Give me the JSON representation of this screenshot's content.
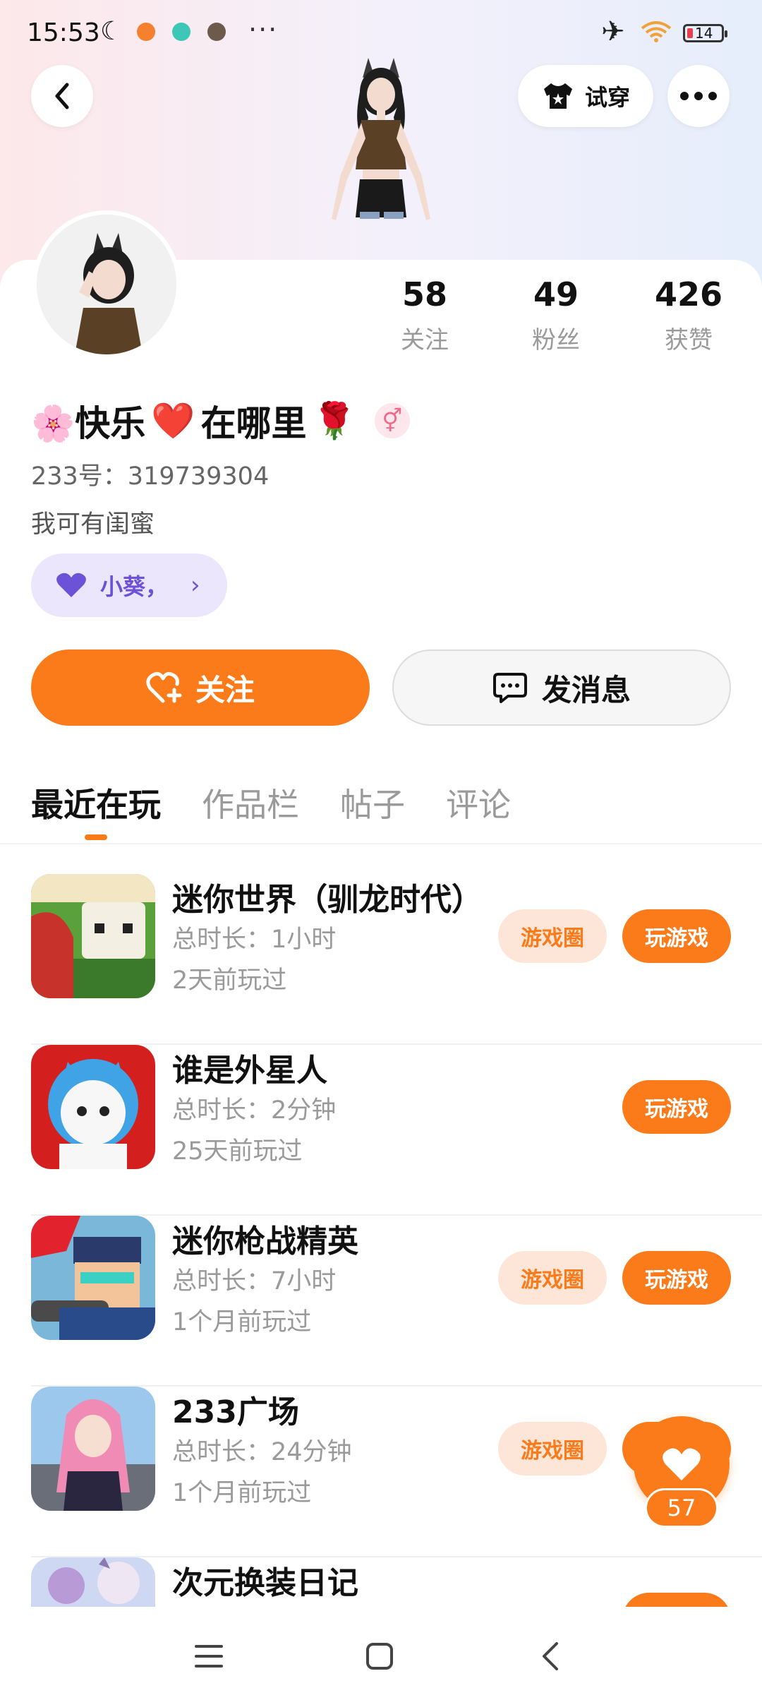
{
  "status_bar": {
    "time": "15:53",
    "battery": "14",
    "more": "···"
  },
  "header": {
    "try_on_label": "试穿"
  },
  "stats": [
    {
      "value": "58",
      "label": "关注"
    },
    {
      "value": "49",
      "label": "粉丝"
    },
    {
      "value": "426",
      "label": "获赞"
    }
  ],
  "profile": {
    "nickname_pre": "🌸快乐",
    "nickname_heart": "❤️",
    "nickname_mid": "在哪里",
    "nickname_post": "🌹",
    "gender_symbol": "⚥",
    "uid": "233号：319739304",
    "bio": "我可有闺蜜",
    "bestie_name": "小葵，"
  },
  "actions": {
    "follow_label": "关注",
    "message_label": "发消息"
  },
  "tabs": [
    {
      "label": "最近在玩",
      "active": true
    },
    {
      "label": "作品栏",
      "active": false
    },
    {
      "label": "帖子",
      "active": false
    },
    {
      "label": "评论",
      "active": false
    }
  ],
  "games": [
    {
      "name": "迷你世界（驯龙时代）",
      "time": "总时长：1小时",
      "last": "2天前玩过",
      "circle": "游戏圈",
      "play": "玩游戏"
    },
    {
      "name": "谁是外星人",
      "time": "总时长：2分钟",
      "last": "25天前玩过",
      "circle": "",
      "play": "玩游戏"
    },
    {
      "name": "迷你枪战精英",
      "time": "总时长：7小时",
      "last": "1个月前玩过",
      "circle": "游戏圈",
      "play": "玩游戏"
    },
    {
      "name": "233广场",
      "time": "总时长：24分钟",
      "last": "1个月前玩过",
      "circle": "游戏圈",
      "play": ""
    },
    {
      "name": "次元换装日记",
      "time": "",
      "last": "",
      "circle": "",
      "play": ""
    }
  ],
  "like": {
    "count": "57"
  },
  "colors": {
    "accent": "#fb7a1a",
    "accent_soft": "#fde6d7",
    "bestie_bg": "#ebe6fb",
    "bestie_text": "#6b52d6"
  }
}
